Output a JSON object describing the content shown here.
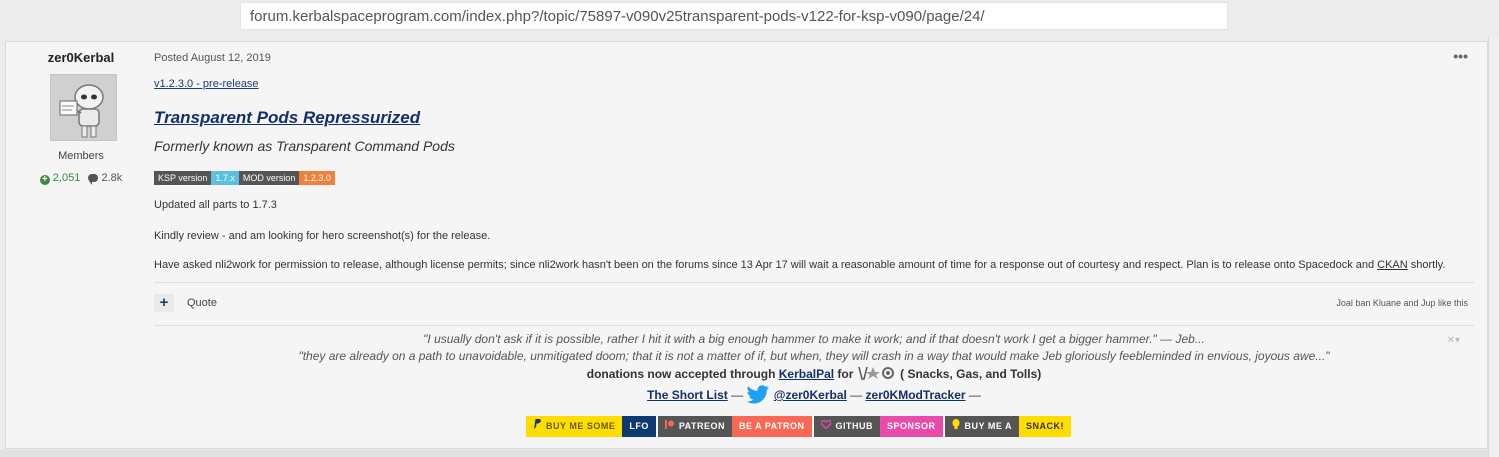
{
  "browser": {
    "url": "forum.kerbalspaceprogram.com/index.php?/topic/75897-v090v25transparent-pods-v122-for-ksp-v090/page/24/"
  },
  "author": {
    "name": "zer0Kerbal",
    "group": "Members",
    "reputation": "2,051",
    "posts": "2.8k"
  },
  "post": {
    "posted": "Posted August 12, 2019",
    "menu": "•••",
    "release_link": "v1.2.3.0 - pre-release",
    "mod_title": "Transparent Pods Repressurized",
    "subtitle": "Formerly known as Transparent Command Pods",
    "badges": {
      "ksp_label": "KSP version",
      "ksp_value": "1.7.x",
      "mod_label": "MOD version",
      "mod_value": "1.2.3.0"
    },
    "para1": "Updated all parts to 1.7.3",
    "para2": "Kindly review - and am looking for hero screenshot(s) for the release.",
    "para3_main": "Have asked nli2work for permission to release, although license permits; since nli2work hasn't been on the forums since 13 Apr 17 will wait a reasonable amount of time for a response out of courtesy and respect. Plan is to release onto Spacedock and ",
    "para3_link": "CKAN",
    "para3_end": " shortly."
  },
  "actions": {
    "plus": "+",
    "quote": "Quote",
    "likes": "Joal ban Kluane and Jup like this"
  },
  "signature": {
    "quote1": "\"I usually don't ask if it is possible, rather I hit it with a big enough hammer to make it work; and if that doesn't work I get a bigger hammer.\"",
    "quote1_attr": " — Jeb...",
    "quote2": "\"they are already on a path to unavoidable, unmitigated doom; that it is not a matter of if, but when, they will crash in a way that would make Jeb gloriously feebleminded in envious, joyous awe...\"",
    "donations_pre": "donations now accepted through ",
    "kerbalpal": "KerbalPal",
    "donations_for": " for ",
    "donations_post": " ( Snacks, Gas, and Tolls)",
    "short_list": "The Short List",
    "dash1": " — ",
    "twitter": "@zer0Kerbal",
    "dash2": " — ",
    "tracker": "zer0KModTracker",
    "dash3": " —",
    "close": "✕▾"
  },
  "sponsors": {
    "buy_me_some": "BUY ME SOME",
    "lfo": "LFO",
    "patreon": "PATREON",
    "be_a_patron": "BE A PATRON",
    "github": "GITHUB",
    "sponsor": "SPONSOR",
    "buy_me_a": "BUY ME A",
    "snack": "SNACK!"
  },
  "icons": {
    "rep": "plus-circle-icon",
    "posts": "comment-icon",
    "twitter": "twitter-bird-icon",
    "paypal": "paypal-icon",
    "patreon": "patreon-icon",
    "github": "heart-icon",
    "snack": "snack-icon"
  },
  "colors": {
    "link": "#12306a",
    "rep": "#3c8a3c",
    "badge_blue": "#5bc0de",
    "badge_orange": "#f0813a",
    "sponsor_yellow": "#ffdd00",
    "sponsor_navy": "#0e3a73",
    "patreon_red": "#f96854",
    "sponsor_pink": "#ea4aaa"
  }
}
